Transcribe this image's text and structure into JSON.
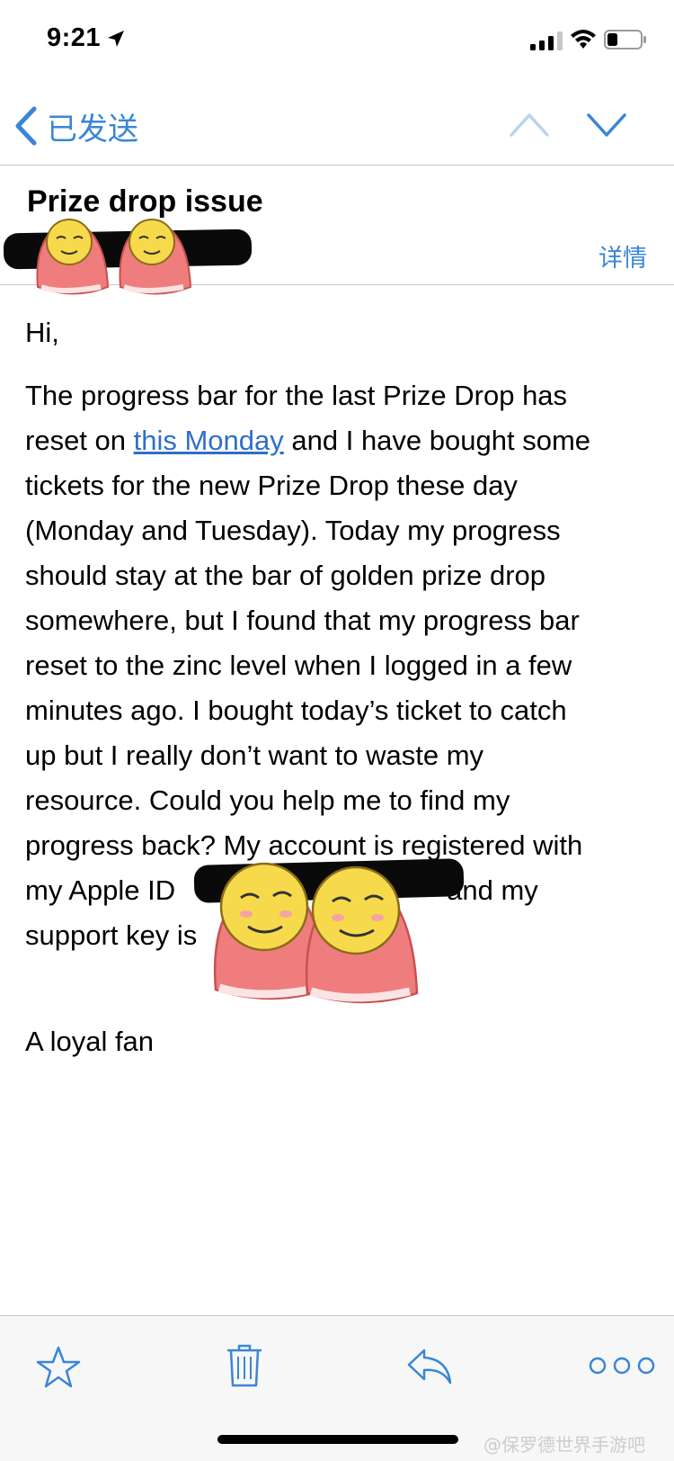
{
  "status_bar": {
    "time": "9:21"
  },
  "nav": {
    "back_label": "已发送"
  },
  "mail": {
    "subject": "Prize drop issue",
    "details_label": "详情",
    "greeting": "Hi,",
    "body_lines": [
      [
        "The progress bar for the last Prize Drop has"
      ],
      [
        "reset on ",
        "this Monday",
        " and I have bought some"
      ],
      [
        "tickets for the new Prize Drop these day"
      ],
      [
        "(Monday and Tuesday). Today my progress"
      ],
      [
        "should stay at the bar of golden prize drop"
      ],
      [
        "somewhere, but I found that my progress bar"
      ],
      [
        "reset to the zinc level when I logged in a few"
      ],
      [
        "minutes ago. I bought today’s ticket to catch"
      ],
      [
        "up but I really don’t want to waste my"
      ],
      [
        "resource. Could you help me to find my"
      ],
      [
        "progress back? My account is registered with"
      ],
      [
        "my Apple ID",
        "and my"
      ],
      [
        "support key is"
      ]
    ],
    "link_text": "this Monday",
    "signoff": "A loyal fan"
  },
  "toolbar": {
    "icons": [
      "star-icon",
      "trash-icon",
      "reply-icon",
      "more-icon"
    ]
  },
  "watermark": "@保罗德世界手游吧",
  "colors": {
    "accent": "#3a86d6",
    "link": "#2f6fc7",
    "toolbar_bg": "#f7f7f7",
    "separator": "#c8c7cc",
    "sticker_face": "#f7d94c",
    "sticker_hood": "#f07d7d"
  }
}
